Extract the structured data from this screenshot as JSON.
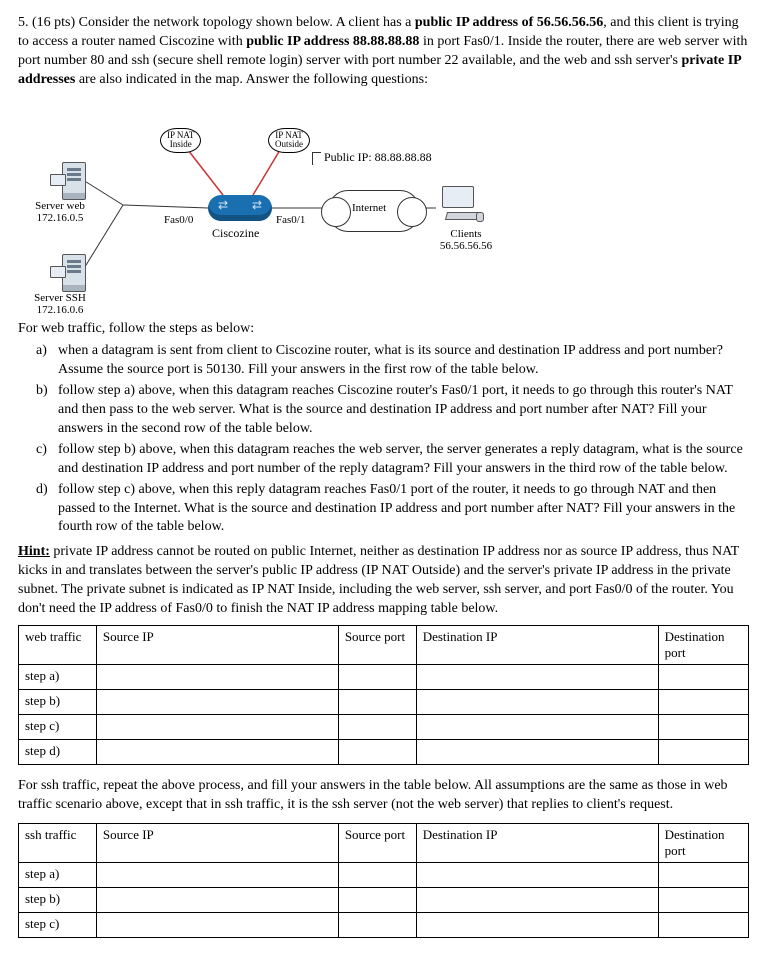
{
  "question": {
    "number": "5.",
    "points": "(16 pts)",
    "intro_1": " Consider the network topology shown below. A client has a ",
    "bold_1": "public IP address of 56.56.56.56",
    "intro_2": ", and this client is trying to access a router named Ciscozine with ",
    "bold_2": "public IP address 88.88.88.88",
    "intro_3": " in port Fas0/1. Inside the router, there are web server with port number 80 and ssh (secure shell remote login) server with port number 22 available, and the web and ssh server's ",
    "bold_3": "private IP addresses",
    "intro_4": " are also indicated in the map. Answer the following questions:"
  },
  "diagram": {
    "nat_inside_1": "IP NAT",
    "nat_inside_2": "Inside",
    "nat_outside_1": "IP NAT",
    "nat_outside_2": "Outside",
    "public_ip": "Public IP: 88.88.88.88",
    "server_web_1": "Server web",
    "server_web_2": "172.16.0.5",
    "server_ssh_1": "Server SSH",
    "server_ssh_2": "172.16.0.6",
    "iface_inside": "Fas0/0",
    "iface_outside": "Fas0/1",
    "router_name": "Ciscozine",
    "internet": "Internet",
    "client_1": "Clients",
    "client_2": "56.56.56.56"
  },
  "steps": {
    "lead": "For web traffic, follow the steps as below:",
    "a": "when a datagram is sent from client to Ciscozine router, what is its source and destination IP address and port number? Assume the source port is 50130. Fill your answers in the first row of the table below.",
    "b": "follow step a) above, when this datagram reaches Ciscozine router's Fas0/1 port, it needs to go through this router's NAT and then pass to the web server. What is the source and destination IP address and port number after NAT? Fill your answers in the second row of the table below.",
    "c": "follow step b) above, when this datagram reaches the web server, the server generates a reply datagram, what is the source and destination IP address and port number of the reply datagram? Fill your answers in the third row of the table below.",
    "d": "follow step c) above, when this reply datagram reaches Fas0/1 port of the router, it needs to go through NAT and then passed to the Internet. What is the source and destination IP address and port number after NAT? Fill your answers in the fourth row of the table below."
  },
  "hint": {
    "label": "Hint:",
    "text": " private IP address cannot be routed on public Internet, neither as destination IP address nor as source IP address, thus NAT kicks in and translates between the server's public IP address (IP NAT Outside) and the server's private IP address in the private subnet. The private subnet is indicated as IP NAT Inside, including the web server, ssh server, and port Fas0/0 of the router. You don't need the IP address of Fas0/0 to finish the NAT IP address mapping table below."
  },
  "table": {
    "h1_web": "web traffic",
    "h1_ssh": "ssh traffic",
    "h2": "Source IP",
    "h3": "Source port",
    "h4": "Destination IP",
    "h5": "Destination port",
    "r1": "step a)",
    "r2": "step b)",
    "r3": "step c)",
    "r4": "step d)"
  },
  "ssh_para": "For ssh traffic, repeat the above process, and fill your answers in the table below. All assumptions are the same as those in web traffic scenario above, except that in ssh traffic, it is the ssh server (not the web server) that replies to client's request."
}
